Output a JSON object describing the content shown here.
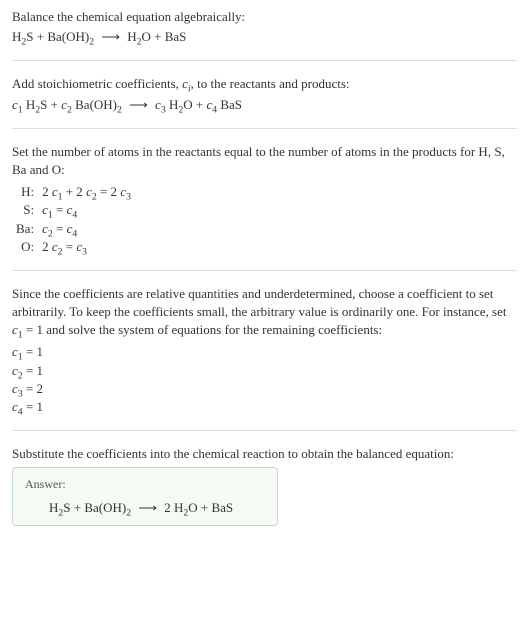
{
  "section1": {
    "text": "Balance the chemical equation algebraically:",
    "equation_html": "H<sub>2</sub>S + Ba(OH)<sub>2</sub> <span class='arrow'>⟶</span> H<sub>2</sub>O + BaS"
  },
  "section2": {
    "text_html": "Add stoichiometric coefficients, <span class='ital'>c<sub class='sub-i'>i</sub></span>, to the reactants and products:",
    "equation_html": "<span class='ital'>c</span><sub>1</sub> H<sub>2</sub>S + <span class='ital'>c</span><sub>2</sub> Ba(OH)<sub>2</sub> <span class='arrow'>⟶</span> <span class='ital'>c</span><sub>3</sub> H<sub>2</sub>O + <span class='ital'>c</span><sub>4</sub> BaS"
  },
  "section3": {
    "text": "Set the number of atoms in the reactants equal to the number of atoms in the products for H, S, Ba and O:",
    "rows": [
      {
        "el": "H:",
        "eq_html": "2 <span class='ital'>c</span><sub>1</sub> + 2 <span class='ital'>c</span><sub>2</sub> = 2 <span class='ital'>c</span><sub>3</sub>"
      },
      {
        "el": "S:",
        "eq_html": "<span class='ital'>c</span><sub>1</sub> = <span class='ital'>c</span><sub>4</sub>"
      },
      {
        "el": "Ba:",
        "eq_html": "<span class='ital'>c</span><sub>2</sub> = <span class='ital'>c</span><sub>4</sub>"
      },
      {
        "el": "O:",
        "eq_html": "2 <span class='ital'>c</span><sub>2</sub> = <span class='ital'>c</span><sub>3</sub>"
      }
    ]
  },
  "section4": {
    "text_html": "Since the coefficients are relative quantities and underdetermined, choose a coefficient to set arbitrarily. To keep the coefficients small, the arbitrary value is ordinarily one. For instance, set <span class='ital'>c</span><sub>1</sub> = 1 and solve the system of equations for the remaining coefficients:",
    "coeffs": [
      {
        "html": "<span class='ital'>c</span><sub>1</sub> = 1"
      },
      {
        "html": "<span class='ital'>c</span><sub>2</sub> = 1"
      },
      {
        "html": "<span class='ital'>c</span><sub>3</sub> = 2"
      },
      {
        "html": "<span class='ital'>c</span><sub>4</sub> = 1"
      }
    ]
  },
  "section5": {
    "text": "Substitute the coefficients into the chemical reaction to obtain the balanced equation:",
    "answer_label": "Answer:",
    "answer_html": "H<sub>2</sub>S + Ba(OH)<sub>2</sub> <span class='arrow'>⟶</span> 2 H<sub>2</sub>O + BaS"
  }
}
